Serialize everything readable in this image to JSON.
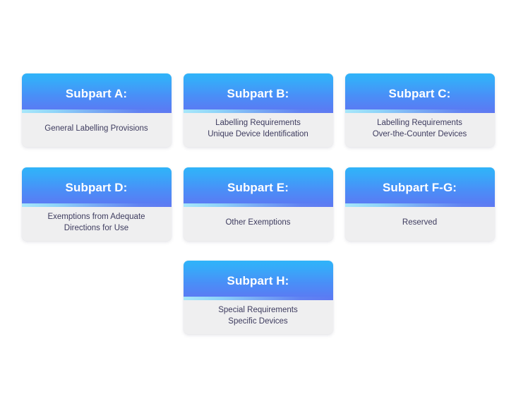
{
  "theme": {
    "page_background": "#ffffff",
    "header_gradient_start": "#2fb4f9",
    "header_gradient_end": "#5f78f2",
    "header_sheen": "#aaebfa",
    "card_body_background": "#efeff0",
    "title_color": "#ffffff",
    "body_text_color": "#3d3b5e"
  },
  "rows": [
    {
      "cards": [
        {
          "title": "Subpart A:",
          "body": "General Labelling Provisions"
        },
        {
          "title": "Subpart B:",
          "body": "Labelling Requirements\nUnique Device Identification"
        },
        {
          "title": "Subpart C:",
          "body": "Labelling Requirements\nOver-the-Counter Devices"
        }
      ]
    },
    {
      "cards": [
        {
          "title": "Subpart D:",
          "body": "Exemptions from Adequate\nDirections for Use"
        },
        {
          "title": "Subpart E:",
          "body": "Other Exemptions"
        },
        {
          "title": "Subpart F-G:",
          "body": "Reserved"
        }
      ]
    },
    {
      "cards": [
        {
          "title": "Subpart H:",
          "body": "Special Requirements\nSpecific Devices"
        }
      ]
    }
  ]
}
